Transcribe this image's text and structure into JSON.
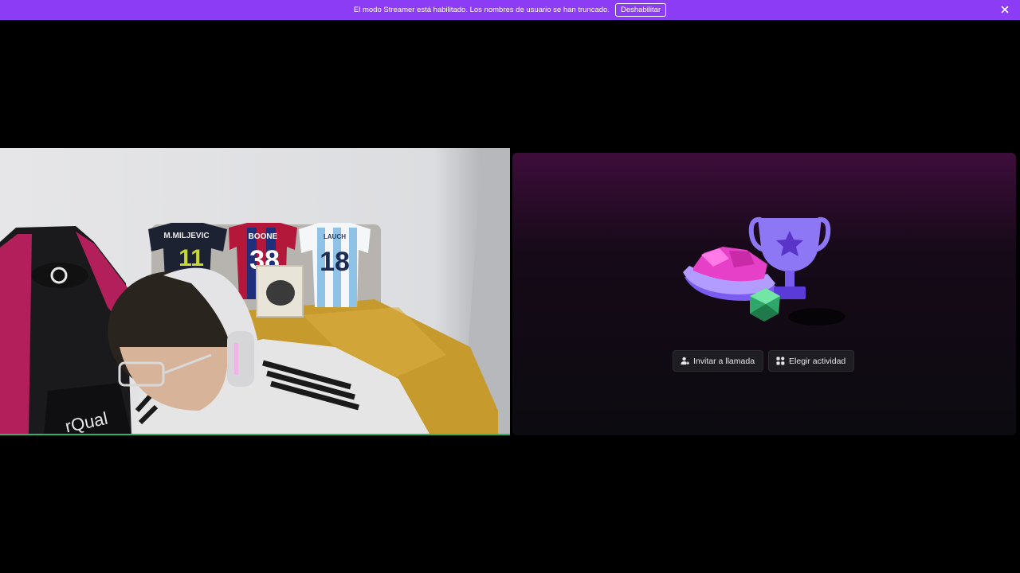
{
  "banner": {
    "message": "El modo Streamer está habilitado. Los nombres de usuario se han truncado.",
    "disable_label": "Deshabilitar"
  },
  "call": {
    "invite_label": "Invitar a llamada",
    "activity_label": "Elegir actividad"
  },
  "video": {
    "jersey_1": {
      "name": "M.MILJEVIC",
      "number": "11"
    },
    "jersey_2": {
      "name": "BOONE",
      "number": "38"
    },
    "jersey_3": {
      "name": "LAUCH",
      "number": "18"
    },
    "chair_brand": "rQual"
  },
  "colors": {
    "banner": "#8c3cf5",
    "speaking_ring": "#2eb36a",
    "tile_bg": "#0c0b10"
  },
  "icons": {
    "close": "close-icon",
    "invite": "add-user-icon",
    "activity": "activity-grid-icon"
  }
}
